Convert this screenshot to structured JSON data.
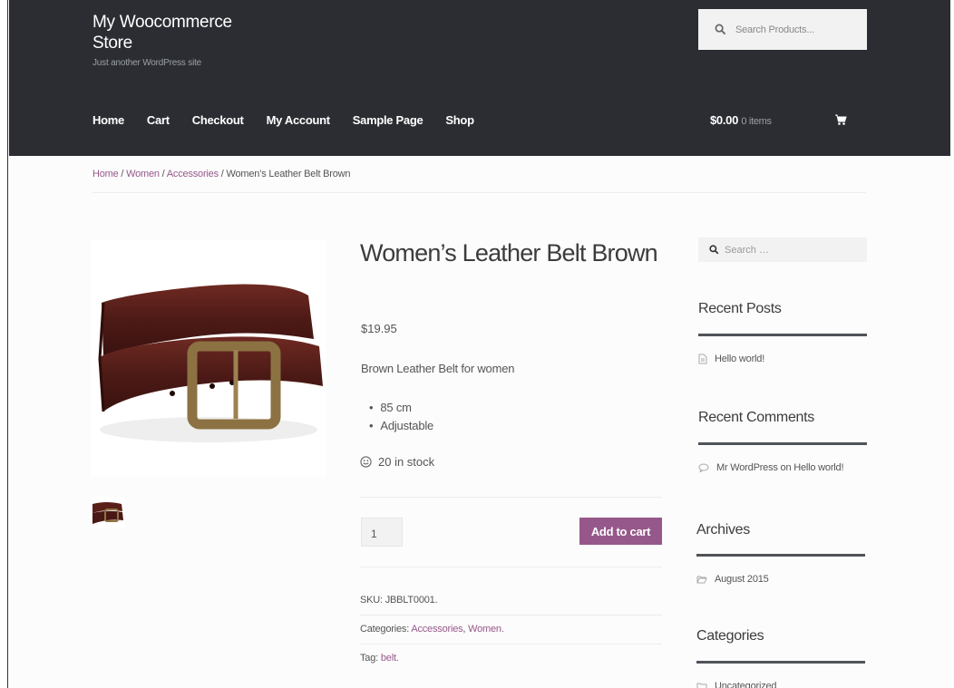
{
  "site": {
    "title": "My Woocommerce Store",
    "tagline": "Just another WordPress site"
  },
  "header_search": {
    "placeholder": "Search Products..."
  },
  "nav": [
    "Home",
    "Cart",
    "Checkout",
    "My Account",
    "Sample Page",
    "Shop"
  ],
  "cart": {
    "amount": "$0.00",
    "items": "0 items"
  },
  "breadcrumb": {
    "home": "Home",
    "sep": " / ",
    "women": "Women",
    "accessories": "Accessories",
    "current": "Women’s Leather Belt Brown"
  },
  "product": {
    "title": "Women’s Leather Belt Brown",
    "price": "$19.95",
    "description": "Brown Leather Belt for women",
    "features": [
      "85 cm",
      "Adjustable"
    ],
    "stock": "20 in stock",
    "quantity": "1",
    "add_to_cart": "Add to cart",
    "sku_label": "SKU:",
    "sku": "JBBLT0001.",
    "categories_label": "Categories:",
    "category_1": "Accessories",
    "category_2": "Women.",
    "category_sep": ",",
    "tag_label": "Tag:",
    "tag": "belt."
  },
  "sidebar": {
    "search_placeholder": "Search …",
    "recent_posts_title": "Recent Posts",
    "recent_post_1": "Hello world!",
    "recent_comments_title": "Recent Comments",
    "comment_1": "Mr WordPress on Hello world!",
    "archives_title": "Archives",
    "archive_1": "August 2015",
    "categories_title": "Categories",
    "category_1": "Uncategorized"
  },
  "colors": {
    "header_bg": "#2c2d33",
    "accent": "#96588a",
    "widget_rule": "#505359"
  }
}
